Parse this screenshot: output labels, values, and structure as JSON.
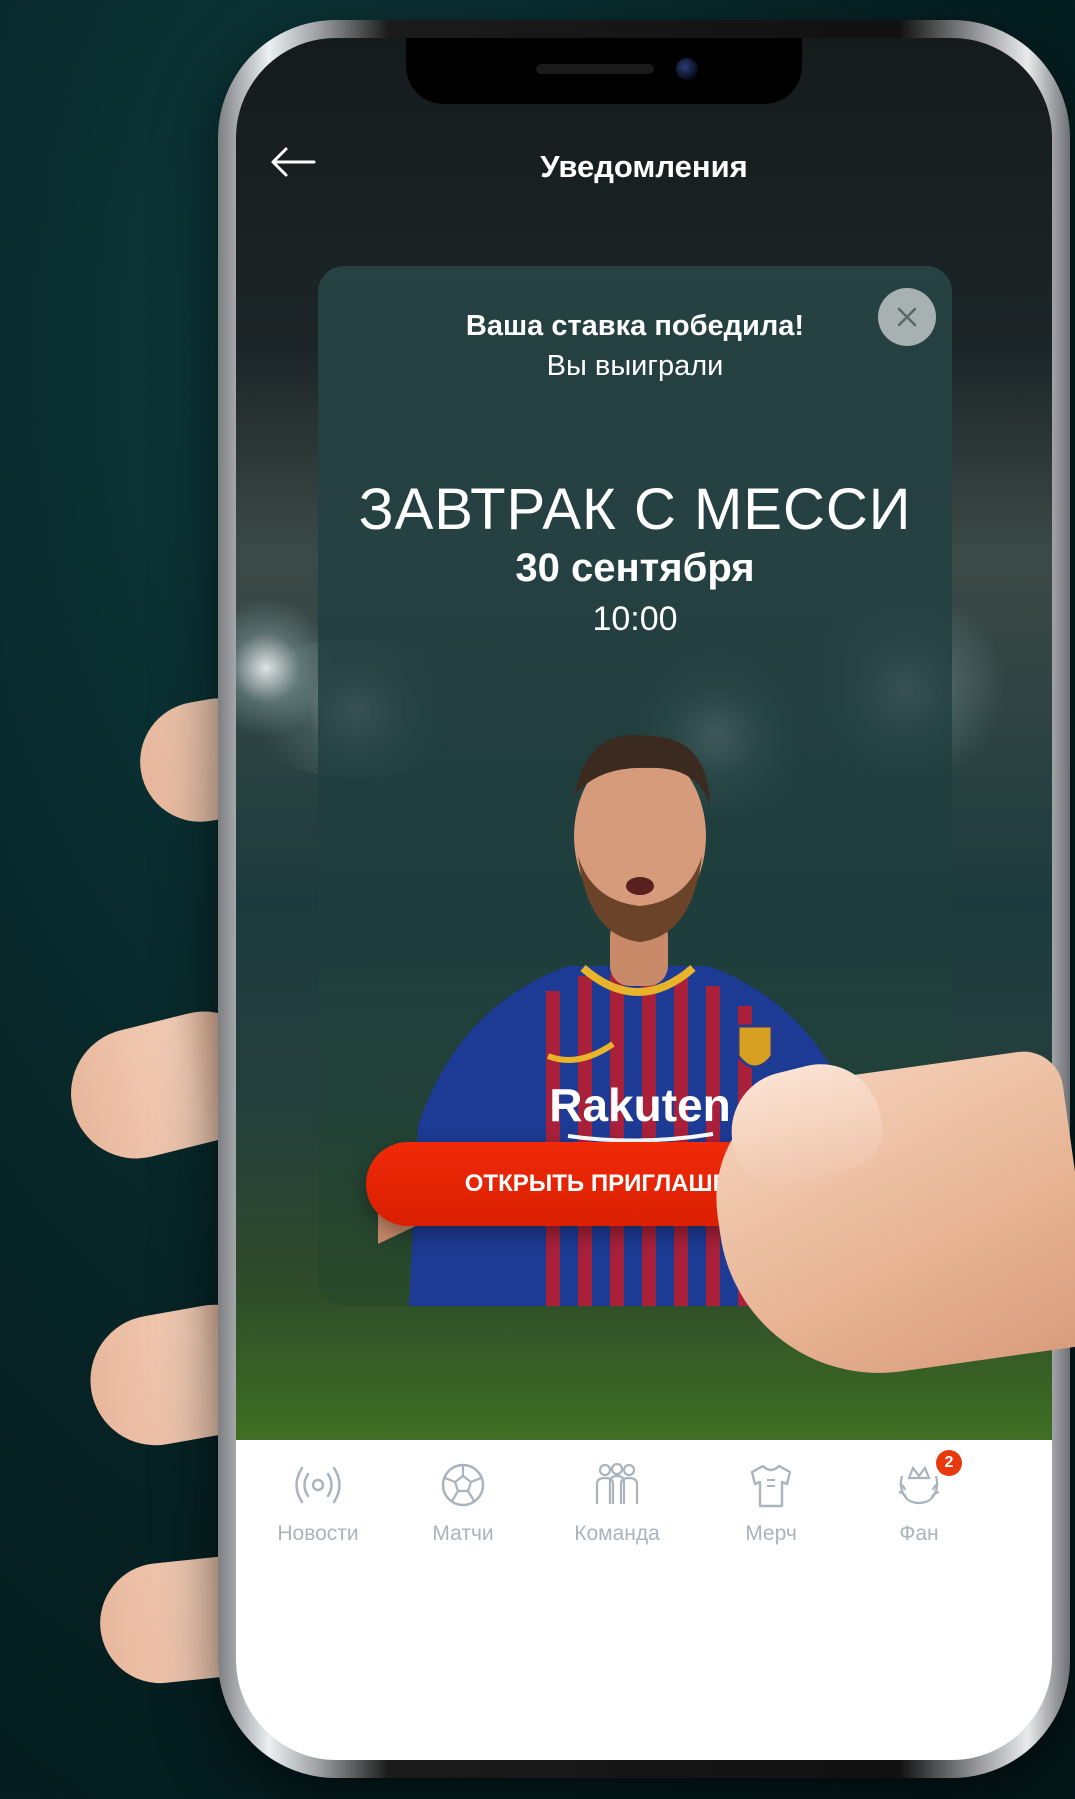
{
  "header": {
    "title": "Уведомления",
    "back_icon": "arrow-left-icon"
  },
  "notification": {
    "headline": "Ваша ставка победила!",
    "subline": "Вы выиграли",
    "close_icon": "close-icon",
    "event_title": "ЗАВТРАК С МЕССИ",
    "event_date": "30 сентября",
    "event_time": "10:00",
    "jersey_sponsor": "Rakuten",
    "cta_label": "ОТКРЫТЬ ПРИГЛАШЕНИЕ"
  },
  "tabbar": {
    "items": [
      {
        "label": "Новости",
        "icon": "broadcast-icon"
      },
      {
        "label": "Матчи",
        "icon": "soccer-ball-icon"
      },
      {
        "label": "Команда",
        "icon": "team-icon"
      },
      {
        "label": "Мерч",
        "icon": "shirt-icon"
      },
      {
        "label": "Фан",
        "icon": "laurel-crown-icon",
        "badge": "2"
      }
    ]
  },
  "colors": {
    "accent": "#e32500",
    "tab_label": "#aab4bd",
    "badge": "#e8380d"
  }
}
